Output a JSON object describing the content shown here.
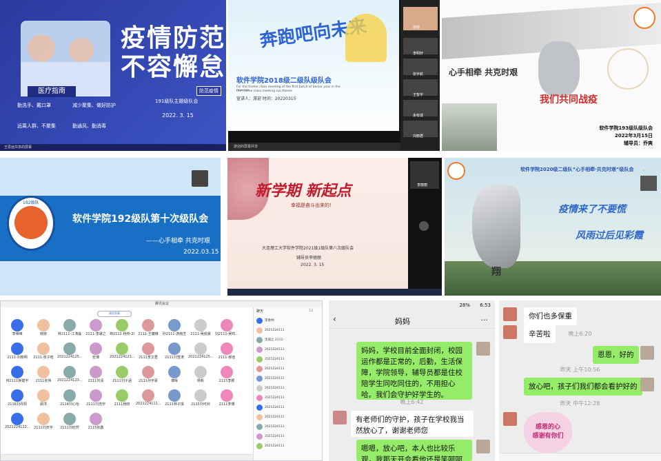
{
  "tile1": {
    "title_line1": "疫情防范",
    "title_line2": "不容懈怠",
    "banner": "医疗指南",
    "subtitle": "191级队主题级队会",
    "date": "2022. 3. 15",
    "tips": [
      "勤洗手、戴口罩",
      "减少聚集、做好防护",
      "远离人群、不聚集",
      "勤通风、勤消毒"
    ],
    "badge": "防范疫情",
    "footer": "王思远共享的屏幕"
  },
  "tile2": {
    "title": "奔跑吧向未来",
    "subtitle": "软件学院2018级二级队级队会",
    "tagline": "For the theme class meeting of the first batch of Senior year in the new run",
    "tagline2": "the theme class meeting run theme",
    "info": "宣讲人：游迎    时间：20220315",
    "participants": [
      "游迎",
      "李明轩",
      "张宇航",
      "王智宇",
      "余有成",
      "刘丽君"
    ],
    "footer": "游迎的屏幕共享",
    "colors": {
      "accent": "#2e63d3"
    }
  },
  "tile3": {
    "slogan1": "心手相牵 共克时艰",
    "slogan2": "我们共同战疫",
    "caption1": "软件学院193级队级队会",
    "caption2": "2022年3月15日",
    "caption3": "辅导员：乔爽",
    "logo": "SCHOOL OF SOFTWARE & MICROELECTRONICS"
  },
  "tile4": {
    "title": "软件学院192级队第十次级队会",
    "subtitle": "——心手相牵  共克时艰",
    "date": "2022.03.15",
    "logo_text": "192级队"
  },
  "tile5": {
    "title": "新学期 新起点",
    "subtitle": "幸福是奋斗出来的！",
    "line1": "大连理工大学软件学院2021级1级队第八次级队会",
    "line2": "辅导员李丽丽",
    "line3": "2022. 3. 15",
    "participant": "李丽丽"
  },
  "tile6": {
    "header": "软件学院2020级二级队“心手相牵·共克时艰”级队会",
    "slogan1": "疫情来了不要慌",
    "slogan2": "风雨过后见彩霞",
    "engraving": "翔"
  },
  "tile7": {
    "window_title": "腾讯会议",
    "tabs": [
      "成员列表",
      "聊天"
    ],
    "participants": [
      "李维维",
      "晓晓",
      "林2111-江涛淼",
      "2111-李晟之",
      "林2112-杨桥-202...",
      "2111-王婕琳",
      "孙2111-游雨芝",
      "2111-吴俊晨",
      "刘2111-吴鸣...",
      "2111-刘晓明",
      "2111-张子晗",
      "2021224125...",
      "宏博",
      "2021224121...",
      "2111李文君",
      "2111刘雪涛",
      "2021224125...",
      "2111-郝佳",
      "林2111钟建宇",
      "2111张伟",
      "2021224123...",
      "2111刘清",
      "2111刘子涵",
      "2111孙宇豪",
      "博晖",
      "杨帆",
      "2115李颖",
      "2116刘丹阳",
      "顾洋",
      "2114刘心怡",
      "2111刘浩宇",
      "2111杨晓",
      "2021224111...",
      "2111林子琪",
      "2115刘可欣",
      "2111李博",
      "2021224122...",
      "2111刘天宇",
      "2111刘欣然",
      "2115张鑫"
    ],
    "chat_items": [
      "李春林",
      "2021224111",
      "沈诚之 2111-",
      "2021224111",
      "2021224111",
      "2021224111",
      "2021224111",
      "2021224111",
      "2021224111",
      "2021224111",
      "2021224111",
      "2021224111",
      "2021224111",
      "2021224111"
    ],
    "chat_count": "12"
  },
  "tile8": {
    "status_time": "6:53",
    "battery": "28%",
    "contact": "妈妈",
    "msg1": "妈妈，学校目前全面封闭，校园运作都是正常的，后勤，生活保障，学院领导，辅导员都是住校陪学生同吃同住的，不用担心哈。我们会守护好学生的。",
    "time1": "晚上6:42",
    "msg2": "有老师们的守护，孩子在学校我当然放心了，谢谢老师您",
    "msg3": "嗯嗯，放心吧，本人也比较乐观，我那天开会看他还是笑呵呵"
  },
  "tile9": {
    "msg1": "你们也多保重",
    "msg2": "辛苦啦",
    "time1": "晚上6:20",
    "msg3": "恩恩，好的",
    "time2": "昨天 上午10:56",
    "msg4": "放心吧，孩子们我们都会看护好的",
    "time3": "昨天 中午12:28",
    "sticker1": "感恩的心",
    "sticker2": "感谢有你们"
  }
}
